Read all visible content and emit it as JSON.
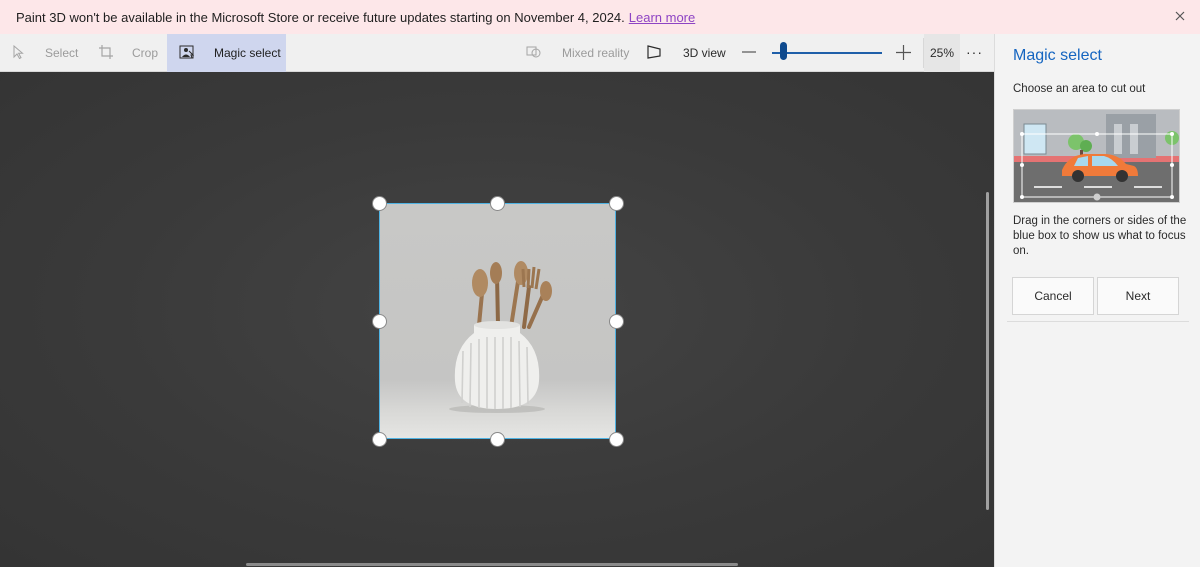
{
  "banner": {
    "message": "Paint 3D won't be available in the Microsoft Store or receive future updates starting on November 4, 2024.",
    "link": "Learn more"
  },
  "toolbar": {
    "select_label": "Select",
    "crop_label": "Crop",
    "magic_select_label": "Magic select",
    "mixed_reality_label": "Mixed reality",
    "view3d_label": "3D view",
    "zoom_value": "25%",
    "more_label": "···"
  },
  "panel": {
    "title": "Magic select",
    "subtitle": "Choose an area to cut out",
    "description": "Drag in the corners or sides of the blue box to show us what to focus on.",
    "cancel_label": "Cancel",
    "next_label": "Next"
  },
  "colors": {
    "accent": "#1565c0",
    "active_tool_bg": "#cfd6ee",
    "selection_border": "#4fb3e3",
    "banner_bg": "#fde7e9"
  }
}
